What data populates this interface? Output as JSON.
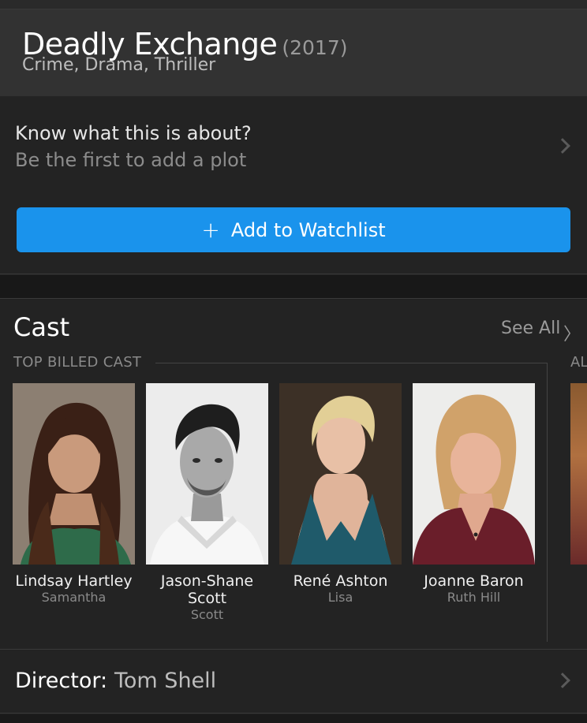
{
  "movie": {
    "title": "Deadly Exchange",
    "year": "(2017)",
    "genres": "Crime, Drama, Thriller"
  },
  "plot": {
    "heading": "Know what this is about?",
    "subtext": "Be the first to add a plot"
  },
  "watchlist": {
    "icon": "+",
    "label": "Add to Watchlist",
    "color": "#1a93ec"
  },
  "cast": {
    "heading": "Cast",
    "see_all_label": "See All",
    "see_all_chevron": "〉",
    "subheading": "TOP BILLED CAST",
    "next_group_label": "AL",
    "members": [
      {
        "name": "Lindsay Hartley",
        "role": "Samantha"
      },
      {
        "name": "Jason-Shane Scott",
        "role": "Scott"
      },
      {
        "name": "René Ashton",
        "role": "Lisa"
      },
      {
        "name": "Joanne Baron",
        "role": "Ruth Hill"
      }
    ]
  },
  "director": {
    "label": "Director:",
    "name": "Tom Shell"
  },
  "colors": {
    "background": "#212121",
    "title_bar": "#323232",
    "accent": "#1a93ec"
  }
}
